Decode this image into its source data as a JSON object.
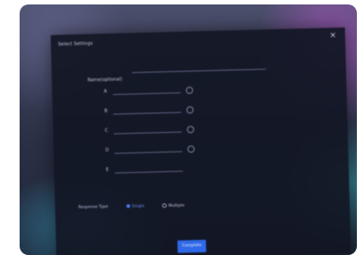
{
  "dialog": {
    "title": "Select Settings",
    "close_symbol": "×"
  },
  "name_field": {
    "label": "Name(optional)",
    "value": ""
  },
  "options": [
    {
      "letter": "A",
      "value": ""
    },
    {
      "letter": "B",
      "value": ""
    },
    {
      "letter": "C",
      "value": ""
    },
    {
      "letter": "D",
      "value": ""
    },
    {
      "letter": "E",
      "value": ""
    }
  ],
  "response": {
    "label": "Response Type",
    "single_label": "Single",
    "multiple_label": "Multiple",
    "selected": "single"
  },
  "complete_label": "Complete",
  "icons": {
    "close": "close-icon",
    "remove": "minus-circle-icon",
    "radio": "radio-icon"
  },
  "colors": {
    "accent": "#2f68e8",
    "dialog_bg": "#12161f"
  }
}
